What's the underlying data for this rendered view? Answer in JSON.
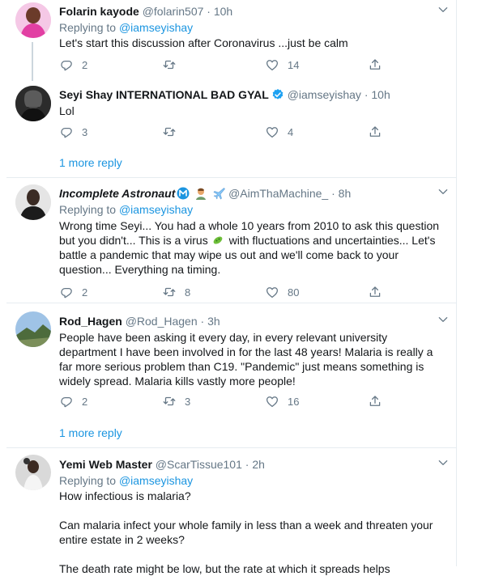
{
  "tweets": [
    {
      "name": "Folarin kayode",
      "handle": "@folarin507",
      "time": "10h",
      "replying_label": "Replying to",
      "replying_to": "@iamseyishay",
      "text": "Let's  start this discussion  after Coronavirus ...just be calm",
      "replies": "2",
      "retweets": "",
      "likes": "14"
    },
    {
      "name": "Seyi Shay INTERNATIONAL BAD GYAL",
      "handle": "@iamseyishay",
      "time": "10h",
      "text": "Lol",
      "replies": "3",
      "retweets": "",
      "likes": "4",
      "more_replies": "1 more reply"
    },
    {
      "name": "Incomplete Astronaut",
      "handle": "@AimThaMachine_",
      "time": "8h",
      "replying_label": "Replying to",
      "replying_to": "@iamseyishay",
      "text_lines": [
        "Wrong time Seyi... You had a whole 10 years from 2010 to ask this question",
        "but you didn't... This is a virus",
        " with fluctuations and uncertainties... Let's",
        "battle a pandemic that may wipe us out and we'll come back to your",
        "question... Everything na timing."
      ],
      "replies": "2",
      "retweets": "8",
      "likes": "80"
    },
    {
      "name": "Rod_Hagen",
      "handle": "@Rod_Hagen",
      "time": "3h",
      "text_lines": [
        "People have been asking it every day, in every  relevant university",
        "department I have been involved in for the last 48 years! Malaria is really a",
        "far more serious problem than C19. \"Pandemic\" just means something is",
        "widely spread. Malaria kills vastly more people!"
      ],
      "replies": "2",
      "retweets": "3",
      "likes": "16",
      "more_replies": "1 more reply"
    },
    {
      "name": "Yemi Web Master",
      "handle": "@ScarTissue101",
      "time": "2h",
      "replying_label": "Replying to",
      "replying_to": "@iamseyishay",
      "text_lines": [
        "How infectious is malaria?",
        "Can malaria infect your whole family in less than a week and threaten your",
        "entire estate in 2 weeks?",
        "The death rate might be low, but the rate at which it spreads helps"
      ]
    }
  ],
  "dot": "·",
  "icons": [
    "reply-icon",
    "retweet-icon",
    "like-icon",
    "share-icon",
    "chevron-down-icon",
    "verified-badge-icon"
  ],
  "colors": {
    "link": "#1b95e0",
    "muted": "#657786",
    "text": "#14171a",
    "border": "#e6ecf0",
    "verified": "#1da1f2"
  }
}
